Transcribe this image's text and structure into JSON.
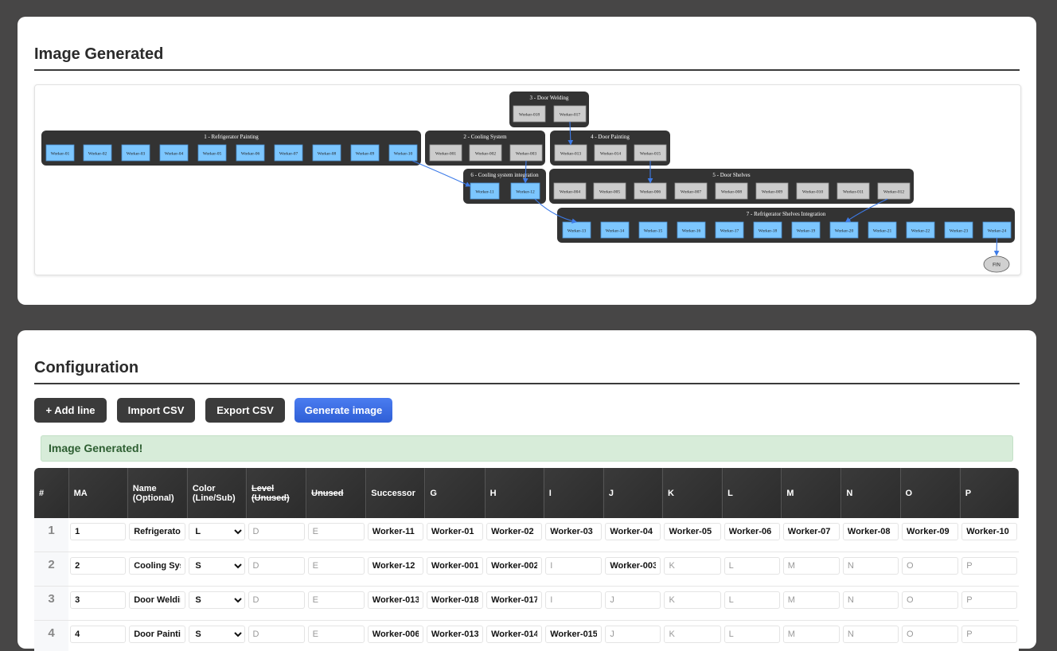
{
  "image_card": {
    "title": "Image Generated"
  },
  "graph": {
    "clusters": [
      {
        "label": "3 - Door Welding",
        "workers": [
          "Worker-018",
          "Worker-017"
        ]
      },
      {
        "label": "1 - Refrigerator Painting",
        "workers": [
          "Worker-01",
          "Worker-02",
          "Worker-03",
          "Worker-04",
          "Worker-05",
          "Worker-06",
          "Worker-07",
          "Worker-08",
          "Worker-09",
          "Worker-10"
        ]
      },
      {
        "label": "2 - Cooling System",
        "workers": [
          "Worker-001",
          "Worker-002",
          "Worker-003"
        ]
      },
      {
        "label": "4 - Door Painting",
        "workers": [
          "Worker-013",
          "Worker-014",
          "Worker-015"
        ]
      },
      {
        "label": "6 - Cooling system integration",
        "workers": [
          "Worker-11",
          "Worker-12"
        ]
      },
      {
        "label": "5 - Door Shelves",
        "workers": [
          "Worker-004",
          "Worker-005",
          "Worker-006",
          "Worker-007",
          "Worker-008",
          "Worker-009",
          "Worker-010",
          "Worker-011",
          "Worker-012"
        ]
      },
      {
        "label": "7 - Refrigerator Shelves Integration",
        "workers": [
          "Worker-13",
          "Worker-14",
          "Worker-15",
          "Worker-16",
          "Worker-17",
          "Worker-18",
          "Worker-19",
          "Worker-20",
          "Worker-21",
          "Worker-22",
          "Worker-23",
          "Worker-24"
        ]
      }
    ],
    "end_node": "FIN",
    "colors": {
      "cluster_bg": "#333333",
      "line_node": "#7cc6fe",
      "sub_node": "#cccccc",
      "edge": "#3d7be8"
    }
  },
  "config_card": {
    "title": "Configuration",
    "buttons": {
      "add_line": "+ Add line",
      "import_csv": "Import CSV",
      "export_csv": "Export CSV",
      "generate": "Generate image"
    },
    "alert": "Image Generated!"
  },
  "table": {
    "headers": [
      "#",
      "MA",
      "Name (Optional)",
      "Color (Line/Sub)",
      "Level (Unused)",
      "Unused",
      "Successor",
      "G",
      "H",
      "I",
      "J",
      "K",
      "L",
      "M",
      "N",
      "O",
      "P"
    ],
    "color_options": [
      "L",
      "S"
    ],
    "rows": [
      {
        "num": "1",
        "ma": "1",
        "name": "Refrigerator Painting",
        "color": "L",
        "successor": "Worker-11",
        "g": "Worker-01",
        "h": "Worker-02",
        "i": "Worker-03",
        "j": "Worker-04",
        "k": "Worker-05",
        "l": "Worker-06",
        "m": "Worker-07",
        "n": "Worker-08",
        "o": "Worker-09",
        "p": "Worker-10"
      },
      {
        "num": "2",
        "ma": "2",
        "name": "Cooling System",
        "color": "S",
        "successor": "Worker-12",
        "g": "Worker-001",
        "h": "Worker-002",
        "i": "",
        "j": "Worker-003",
        "k": "",
        "l": "",
        "m": "",
        "n": "",
        "o": "",
        "p": ""
      },
      {
        "num": "3",
        "ma": "3",
        "name": "Door Welding",
        "color": "S",
        "successor": "Worker-013",
        "g": "Worker-018",
        "h": "Worker-017",
        "i": "",
        "j": "",
        "k": "",
        "l": "",
        "m": "",
        "n": "",
        "o": "",
        "p": ""
      },
      {
        "num": "4",
        "ma": "4",
        "name": "Door Painting",
        "color": "S",
        "successor": "Worker-006",
        "g": "Worker-013",
        "h": "Worker-014",
        "i": "Worker-015",
        "j": "",
        "k": "",
        "l": "",
        "m": "",
        "n": "",
        "o": "",
        "p": ""
      }
    ],
    "placeholders": {
      "d": "D",
      "e": "E",
      "i": "I",
      "j": "J",
      "k": "K",
      "l": "L",
      "m": "M",
      "n": "N",
      "o": "O",
      "p": "P"
    }
  }
}
